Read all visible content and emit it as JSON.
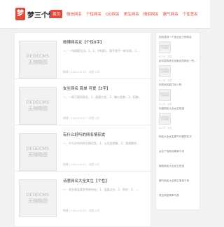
{
  "site": {
    "logo_mark": "梦",
    "logo_text": "梦三个性网"
  },
  "nav": [
    "首页",
    "微信网名",
    "个性网名",
    "QQ网名",
    "男生网名",
    "情侣网名",
    "霸气网名",
    "个性签名"
  ],
  "placeholder": {
    "line1": "DEDECMS",
    "line2": "无缩略图"
  },
  "articles": [
    {
      "title": "微博网名女【个性8字】",
      "desc": "一、一年稳稳当当，1、2、4的第1、我不是不一样字体，人...",
      "meta": "微博 | 2024-05-27 · 浏览 1次"
    },
    {
      "title": "女生网名 简单 可爱【3字】",
      "desc": "一、一般可爱的网名，1、甜甜少女，2、糖心怪兽，3、奶糖...",
      "meta": "微博 | 2024-05-27 · 浏览 1次"
    },
    {
      "title": "有什么好听的网名情侣女",
      "desc": "一、什么好听的网名情侣女，1、以为会就像，2、我想最终...",
      "meta": "微博 | 2024-05-27 · 浏览 1次"
    },
    {
      "title": "诗意网名大全女生【个性】",
      "desc": "一、网名超温柔到哭的诗句，1、温柔过分，2、你好，3、...",
      "meta": "微博 | 2024-05-27 · 浏览 1次"
    }
  ],
  "sidebar": [
    {
      "title": "如何找到一个适合自己的网名",
      "meta": "6-278 · 浏览"
    },
    {
      "title": "用中国传统文化取名的网名一些...",
      "meta": "6-278 · 浏览"
    },
    {
      "title": "你的网名能打动人吗",
      "meta": "6-278 · 浏览"
    },
    {
      "title": "伤感网名大全女生伤感",
      "meta": "6-278 · 浏览"
    },
    {
      "title": "网名大全女生霸气可爱的名字",
      "meta": ""
    },
    {
      "title": "女生个性网名简单干净",
      "meta": ""
    },
    {
      "title": "微信网名大全女生伤感",
      "meta": ""
    },
    {
      "title": "霸气网名大全男生简单干净",
      "meta": ""
    },
    {
      "title": "男生网名简单气质",
      "meta": ""
    }
  ]
}
